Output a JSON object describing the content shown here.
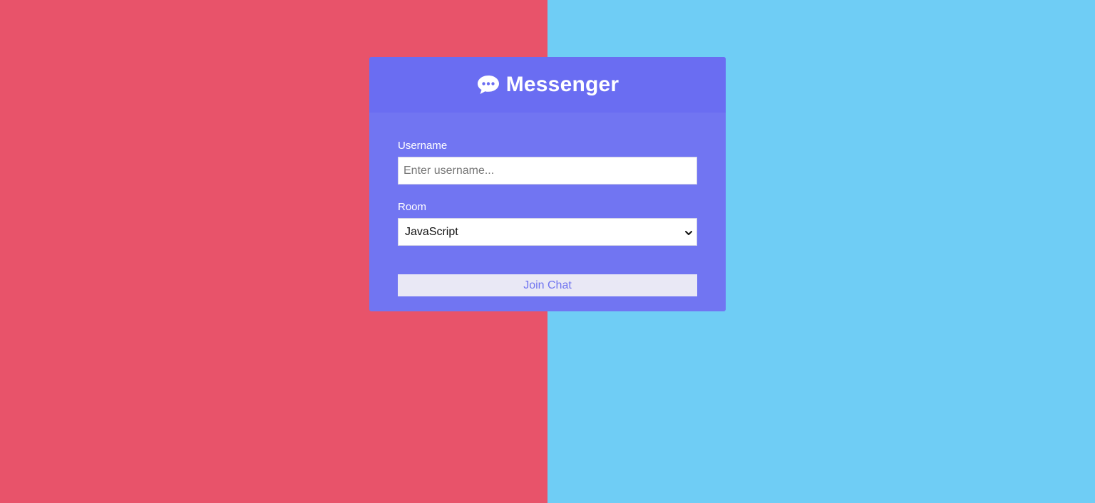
{
  "header": {
    "icon": "chat-bubble-icon",
    "title": "Messenger"
  },
  "form": {
    "username_label": "Username",
    "username_placeholder": "Enter username...",
    "username_value": "",
    "room_label": "Room",
    "room_selected": "JavaScript",
    "join_label": "Join Chat"
  },
  "colors": {
    "left_background": "#e8536a",
    "right_background": "#6fcdf5",
    "card": "#7175f2",
    "card_header": "#6a6df2",
    "button_text": "#7074f0",
    "button_bg": "#e9e8f5"
  }
}
